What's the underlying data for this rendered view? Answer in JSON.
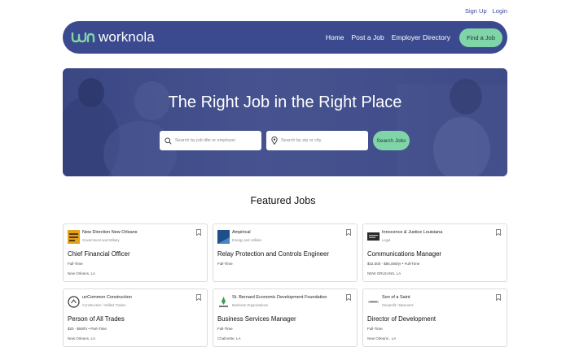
{
  "header": {
    "sign_up": "Sign Up",
    "login": "Login"
  },
  "nav": {
    "logo_text": "worknola",
    "links": [
      "Home",
      "Post a Job",
      "Employer Directory"
    ],
    "cta": "Find a Job"
  },
  "hero": {
    "title": "The Right Job in the Right Place",
    "search_job_placeholder": "Search by job title or employer",
    "search_zip_placeholder": "Search by zip or city",
    "search_button": "Search Jobs"
  },
  "featured": {
    "title": "Featured Jobs",
    "cards": [
      {
        "company": "New Direction New Orleans",
        "category": "Government and Military",
        "title": "Chief Financial Officer",
        "meta": "Full-Time",
        "location": "New Orleans, LA"
      },
      {
        "company": "Ampirical",
        "category": "Energy and Utilities",
        "title": "Relay Protection and Controls Engineer",
        "meta": "Full-Time",
        "location": ""
      },
      {
        "company": "Innocence & Justice Louisiana",
        "category": "Legal",
        "title": "Communications Manager",
        "meta": "$42,000 - $56,000/yr  •  Full-Time",
        "location": "NEW ORLEANS, LA"
      },
      {
        "company": "unCommon Construction",
        "category": "Construction / Skilled Trades",
        "title": "Person of All Trades",
        "meta": "$20 - $50/hr  •  Part-Time",
        "location": "New Orleans, LA"
      },
      {
        "company": "St. Bernard Economic Development Foundation",
        "category": "Business Organizations",
        "title": "Business Services Manager",
        "meta": "Full-Time",
        "location": "Chalmette, LA"
      },
      {
        "company": "Son of a Saint",
        "category": "Nonprofit / Museums",
        "title": "Director of Development",
        "meta": "Full-Time",
        "location": "New Orleans , LA"
      }
    ]
  },
  "colors": {
    "primary": "#3b4a8f",
    "accent": "#7fd4a8"
  }
}
